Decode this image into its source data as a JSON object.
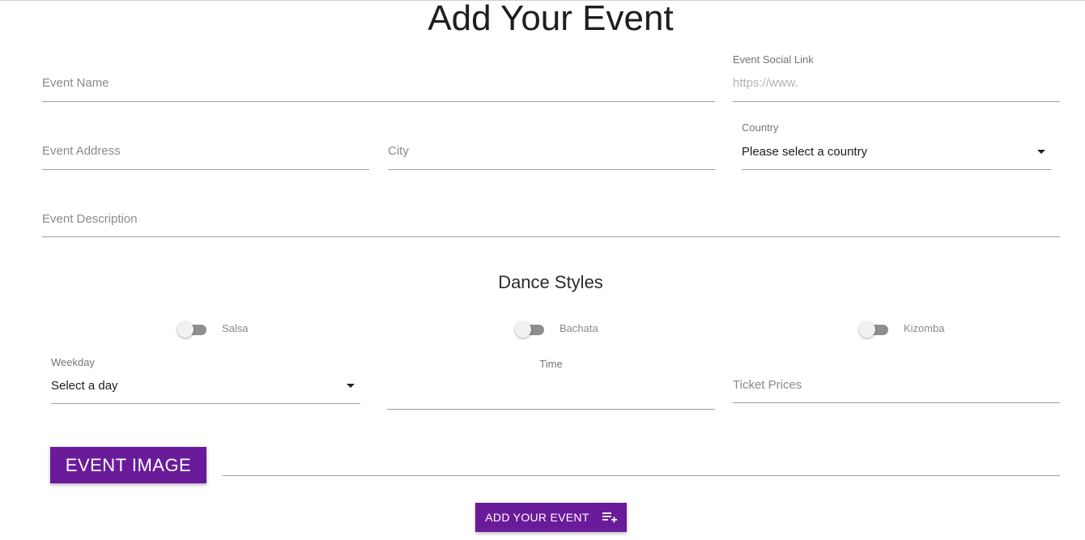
{
  "page": {
    "title": "Add Your Event"
  },
  "fields": {
    "event_name": {
      "placeholder": "Event Name"
    },
    "social_link": {
      "label": "Event Social Link",
      "placeholder": "https://www."
    },
    "event_address": {
      "placeholder": "Event Address"
    },
    "city": {
      "placeholder": "City"
    },
    "country": {
      "label": "Country",
      "value": "Please select a country"
    },
    "description": {
      "placeholder": "Event Description"
    },
    "weekday": {
      "label": "Weekday",
      "value": "Select a day"
    },
    "time": {
      "label": "Time"
    },
    "ticket_prices": {
      "placeholder": "Ticket Prices"
    }
  },
  "dance_styles": {
    "title": "Dance Styles",
    "options": [
      {
        "label": "Salsa",
        "checked": false
      },
      {
        "label": "Bachata",
        "checked": false
      },
      {
        "label": "Kizomba",
        "checked": false
      }
    ]
  },
  "buttons": {
    "event_image": "EVENT IMAGE",
    "submit": "ADD YOUR EVENT",
    "submit_icon": "playlist-add-icon"
  },
  "colors": {
    "accent": "#6a1b9a"
  }
}
